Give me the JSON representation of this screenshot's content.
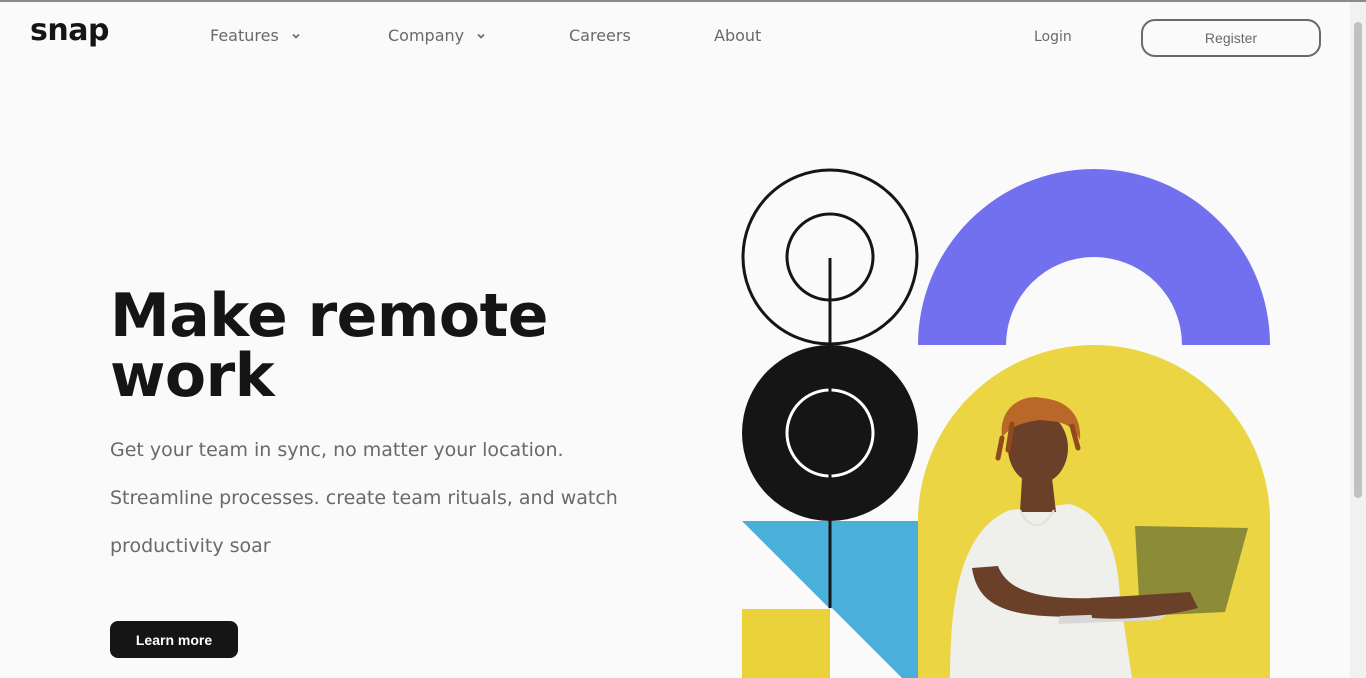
{
  "header": {
    "logo": "snap",
    "nav": [
      {
        "label": "Features",
        "has_dropdown": true,
        "icon": "chevron-down-icon"
      },
      {
        "label": "Company",
        "has_dropdown": true,
        "icon": "chevron-down-icon"
      },
      {
        "label": "Careers",
        "has_dropdown": false
      },
      {
        "label": "About",
        "has_dropdown": false
      }
    ],
    "login": "Login",
    "register": "Register"
  },
  "hero": {
    "title": "Make remote work",
    "description": "Get your team in sync, no matter your location. Streamline processes. create team rituals, and watch productivity soar",
    "cta": "Learn more"
  },
  "art": {
    "image_subject": "person-with-laptop",
    "colors": {
      "purple": "#7270ee",
      "yellow": "#e9d23a",
      "blue": "#4bb0d9",
      "black": "#151515"
    }
  },
  "colors": {
    "background": "#fafafa",
    "text_dark": "#151515",
    "text_gray": "#696969"
  }
}
